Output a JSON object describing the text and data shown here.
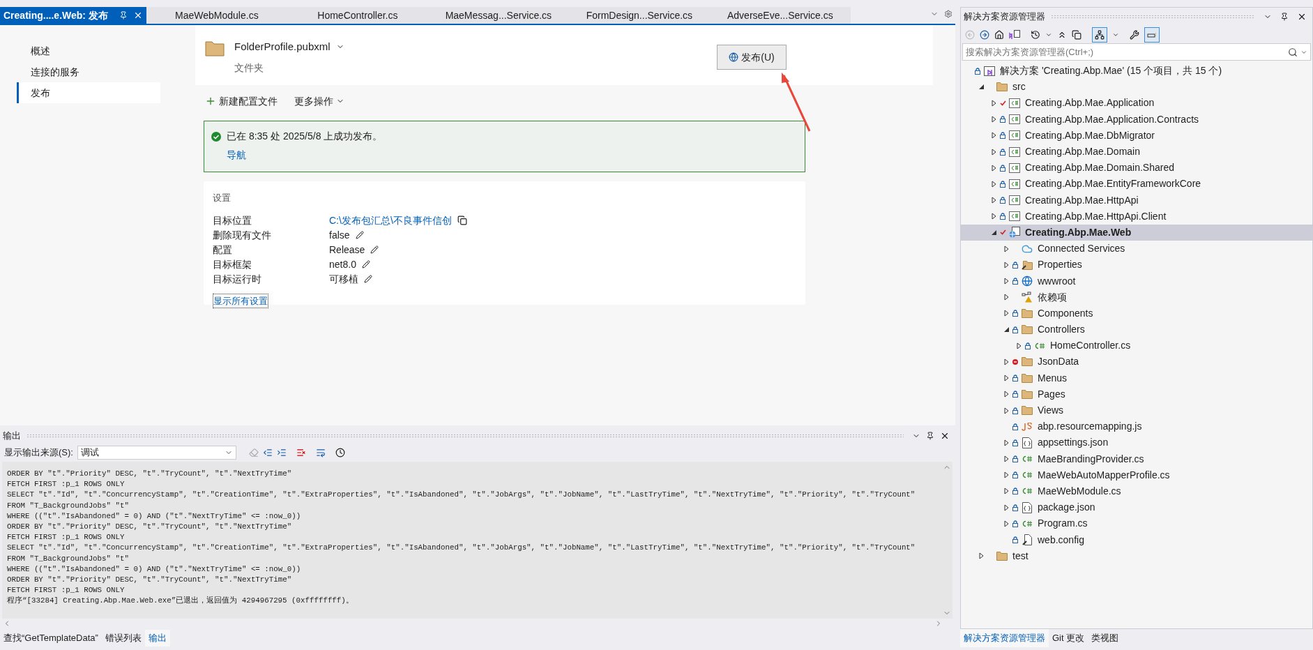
{
  "document_tabs": [
    {
      "label": "Creating....e.Web: 发布",
      "selected": true
    },
    {
      "label": "MaeWebModule.cs",
      "selected": false
    },
    {
      "label": "HomeController.cs",
      "selected": false
    },
    {
      "label": "MaeMessag...Service.cs",
      "selected": false
    },
    {
      "label": "FormDesign...Service.cs",
      "selected": false
    },
    {
      "label": "AdverseEve...Service.cs",
      "selected": false
    }
  ],
  "publish_page": {
    "nav": [
      {
        "label": "概述",
        "selected": false
      },
      {
        "label": "连接的服务",
        "selected": false
      },
      {
        "label": "发布",
        "selected": true
      }
    ],
    "profile": {
      "name": "FolderProfile.pubxml",
      "type": "文件夹",
      "publish_button": "发布(U)"
    },
    "actions": [
      {
        "label": "新建配置文件",
        "kind": "add"
      },
      {
        "label": "更多操作",
        "kind": "menu"
      }
    ],
    "status": {
      "kind": "success",
      "message": "已在 8:35 处 2025/5/8 上成功发布。",
      "link": "导航"
    },
    "settings": {
      "title": "设置",
      "rows": [
        {
          "label": "目标位置",
          "value": "C:\\发布包汇总\\不良事件信创",
          "kind": "link"
        },
        {
          "label": "删除现有文件",
          "value": "false",
          "kind": "editable"
        },
        {
          "label": "配置",
          "value": "Release",
          "kind": "editable"
        },
        {
          "label": "目标框架",
          "value": "net8.0",
          "kind": "editable"
        },
        {
          "label": "目标运行时",
          "value": "可移植",
          "kind": "editable"
        }
      ],
      "show_all": "显示所有设置"
    }
  },
  "output": {
    "title": "输出",
    "source_label": "显示输出来源(S):",
    "source": "调试",
    "lines": [
      "ORDER BY \"t\".\"Priority\" DESC, \"t\".\"TryCount\", \"t\".\"NextTryTime\"",
      "FETCH FIRST :p_1 ROWS ONLY",
      "SELECT \"t\".\"Id\", \"t\".\"ConcurrencyStamp\", \"t\".\"CreationTime\", \"t\".\"ExtraProperties\", \"t\".\"IsAbandoned\", \"t\".\"JobArgs\", \"t\".\"JobName\", \"t\".\"LastTryTime\", \"t\".\"NextTryTime\", \"t\".\"Priority\", \"t\".\"TryCount\"",
      "FROM \"T_BackgroundJobs\" \"t\"",
      "WHERE ((\"t\".\"IsAbandoned\" = 0) AND (\"t\".\"NextTryTime\" <= :now_0))",
      "ORDER BY \"t\".\"Priority\" DESC, \"t\".\"TryCount\", \"t\".\"NextTryTime\"",
      "FETCH FIRST :p_1 ROWS ONLY",
      "SELECT \"t\".\"Id\", \"t\".\"ConcurrencyStamp\", \"t\".\"CreationTime\", \"t\".\"ExtraProperties\", \"t\".\"IsAbandoned\", \"t\".\"JobArgs\", \"t\".\"JobName\", \"t\".\"LastTryTime\", \"t\".\"NextTryTime\", \"t\".\"Priority\", \"t\".\"TryCount\"",
      "FROM \"T_BackgroundJobs\" \"t\"",
      "WHERE ((\"t\".\"IsAbandoned\" = 0) AND (\"t\".\"NextTryTime\" <= :now_0))",
      "ORDER BY \"t\".\"Priority\" DESC, \"t\".\"TryCount\", \"t\".\"NextTryTime\"",
      "FETCH FIRST :p_1 ROWS ONLY",
      "程序“[33284] Creating.Abp.Mae.Web.exe”已退出，返回值为 4294967295 (0xffffffff)。"
    ]
  },
  "bottom_tabs": [
    {
      "label": "查找“GetTemplateData”",
      "selected": false
    },
    {
      "label": "错误列表",
      "selected": false
    },
    {
      "label": "输出",
      "selected": true
    }
  ],
  "solution_explorer": {
    "title": "解决方案资源管理器",
    "search_placeholder": "搜索解决方案资源管理器(Ctrl+;)",
    "tree": [
      {
        "label": "解决方案 'Creating.Abp.Mae' (15 个项目，共 15 个)",
        "kind": "solution",
        "locked": true,
        "checked": false,
        "excluded": false,
        "selected": false,
        "children": [
          {
            "label": "src",
            "kind": "folder",
            "locked": false,
            "checked": false,
            "excluded": false,
            "expanded": true,
            "selected": false,
            "children": [
              {
                "label": "Creating.Abp.Mae.Application",
                "kind": "project",
                "locked": false,
                "checked": true,
                "excluded": false,
                "expanded": false,
                "selected": false
              },
              {
                "label": "Creating.Abp.Mae.Application.Contracts",
                "kind": "project",
                "locked": true,
                "checked": false,
                "excluded": false,
                "expanded": false,
                "selected": false
              },
              {
                "label": "Creating.Abp.Mae.DbMigrator",
                "kind": "project",
                "locked": true,
                "checked": false,
                "excluded": false,
                "expanded": false,
                "selected": false
              },
              {
                "label": "Creating.Abp.Mae.Domain",
                "kind": "project",
                "locked": true,
                "checked": false,
                "excluded": false,
                "expanded": false,
                "selected": false
              },
              {
                "label": "Creating.Abp.Mae.Domain.Shared",
                "kind": "project",
                "locked": true,
                "checked": false,
                "excluded": false,
                "expanded": false,
                "selected": false
              },
              {
                "label": "Creating.Abp.Mae.EntityFrameworkCore",
                "kind": "project",
                "locked": true,
                "checked": false,
                "excluded": false,
                "expanded": false,
                "selected": false
              },
              {
                "label": "Creating.Abp.Mae.HttpApi",
                "kind": "project",
                "locked": true,
                "checked": false,
                "excluded": false,
                "expanded": false,
                "selected": false
              },
              {
                "label": "Creating.Abp.Mae.HttpApi.Client",
                "kind": "project",
                "locked": true,
                "checked": false,
                "excluded": false,
                "expanded": false,
                "selected": false
              },
              {
                "label": "Creating.Abp.Mae.Web",
                "kind": "webproject",
                "locked": false,
                "checked": true,
                "excluded": false,
                "expanded": true,
                "selected": true,
                "children": [
                  {
                    "label": "Connected Services",
                    "kind": "services",
                    "locked": false,
                    "checked": false,
                    "excluded": false,
                    "expanded": false,
                    "selected": false
                  },
                  {
                    "label": "Properties",
                    "kind": "properties",
                    "locked": true,
                    "checked": false,
                    "excluded": false,
                    "expanded": false,
                    "selected": false
                  },
                  {
                    "label": "wwwroot",
                    "kind": "webroot",
                    "locked": true,
                    "checked": false,
                    "excluded": false,
                    "expanded": false,
                    "selected": false
                  },
                  {
                    "label": "依赖项",
                    "kind": "dependencies",
                    "locked": false,
                    "checked": false,
                    "excluded": false,
                    "expanded": false,
                    "selected": false
                  },
                  {
                    "label": "Components",
                    "kind": "folder",
                    "locked": true,
                    "checked": false,
                    "excluded": false,
                    "expanded": false,
                    "selected": false
                  },
                  {
                    "label": "Controllers",
                    "kind": "folder",
                    "locked": true,
                    "checked": false,
                    "excluded": false,
                    "expanded": true,
                    "selected": false,
                    "children": [
                      {
                        "label": "HomeController.cs",
                        "kind": "csharp",
                        "locked": true,
                        "checked": false,
                        "excluded": false,
                        "expanded": false,
                        "selected": false
                      }
                    ]
                  },
                  {
                    "label": "JsonData",
                    "kind": "folder",
                    "locked": false,
                    "checked": false,
                    "excluded": true,
                    "expanded": false,
                    "selected": false
                  },
                  {
                    "label": "Menus",
                    "kind": "folder",
                    "locked": true,
                    "checked": false,
                    "excluded": false,
                    "expanded": false,
                    "selected": false
                  },
                  {
                    "label": "Pages",
                    "kind": "folder",
                    "locked": true,
                    "checked": false,
                    "excluded": false,
                    "expanded": false,
                    "selected": false
                  },
                  {
                    "label": "Views",
                    "kind": "folder",
                    "locked": true,
                    "checked": false,
                    "excluded": false,
                    "expanded": false,
                    "selected": false
                  },
                  {
                    "label": "abp.resourcemapping.js",
                    "kind": "script",
                    "locked": true,
                    "checked": false,
                    "excluded": false,
                    "selected": false
                  },
                  {
                    "label": "appsettings.json",
                    "kind": "json",
                    "locked": true,
                    "checked": false,
                    "excluded": false,
                    "expanded": false,
                    "selected": false
                  },
                  {
                    "label": "MaeBrandingProvider.cs",
                    "kind": "csharp",
                    "locked": true,
                    "checked": false,
                    "excluded": false,
                    "expanded": false,
                    "selected": false
                  },
                  {
                    "label": "MaeWebAutoMapperProfile.cs",
                    "kind": "csharp",
                    "locked": true,
                    "checked": false,
                    "excluded": false,
                    "expanded": false,
                    "selected": false
                  },
                  {
                    "label": "MaeWebModule.cs",
                    "kind": "csharp",
                    "locked": true,
                    "checked": false,
                    "excluded": false,
                    "expanded": false,
                    "selected": false
                  },
                  {
                    "label": "package.json",
                    "kind": "json",
                    "locked": true,
                    "checked": false,
                    "excluded": false,
                    "expanded": false,
                    "selected": false
                  },
                  {
                    "label": "Program.cs",
                    "kind": "csharp",
                    "locked": true,
                    "checked": false,
                    "excluded": false,
                    "expanded": false,
                    "selected": false
                  },
                  {
                    "label": "web.config",
                    "kind": "config",
                    "locked": true,
                    "checked": false,
                    "excluded": false,
                    "selected": false
                  }
                ]
              }
            ]
          },
          {
            "label": "test",
            "kind": "folder",
            "locked": false,
            "checked": false,
            "excluded": false,
            "expanded": false,
            "selected": false
          }
        ]
      }
    ],
    "tabs": [
      {
        "label": "解决方案资源管理器",
        "selected": true
      },
      {
        "label": "Git 更改",
        "selected": false
      },
      {
        "label": "类视图",
        "selected": false
      }
    ]
  }
}
